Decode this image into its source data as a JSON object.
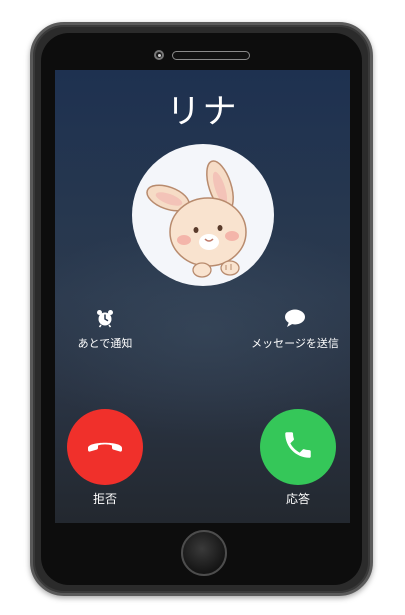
{
  "caller": {
    "name": "リナ"
  },
  "actions": {
    "remind_label": "あとで通知",
    "message_label": "メッセージを送信"
  },
  "buttons": {
    "decline_label": "拒否",
    "accept_label": "応答"
  },
  "icons": {
    "remind": "alarm-clock-icon",
    "message": "speech-bubble-icon",
    "decline": "hang-up-phone-icon",
    "accept": "phone-icon"
  },
  "colors": {
    "decline": "#f0302b",
    "accept": "#35c759",
    "screen_top": "#1e3150",
    "screen_bottom": "#23282f"
  }
}
